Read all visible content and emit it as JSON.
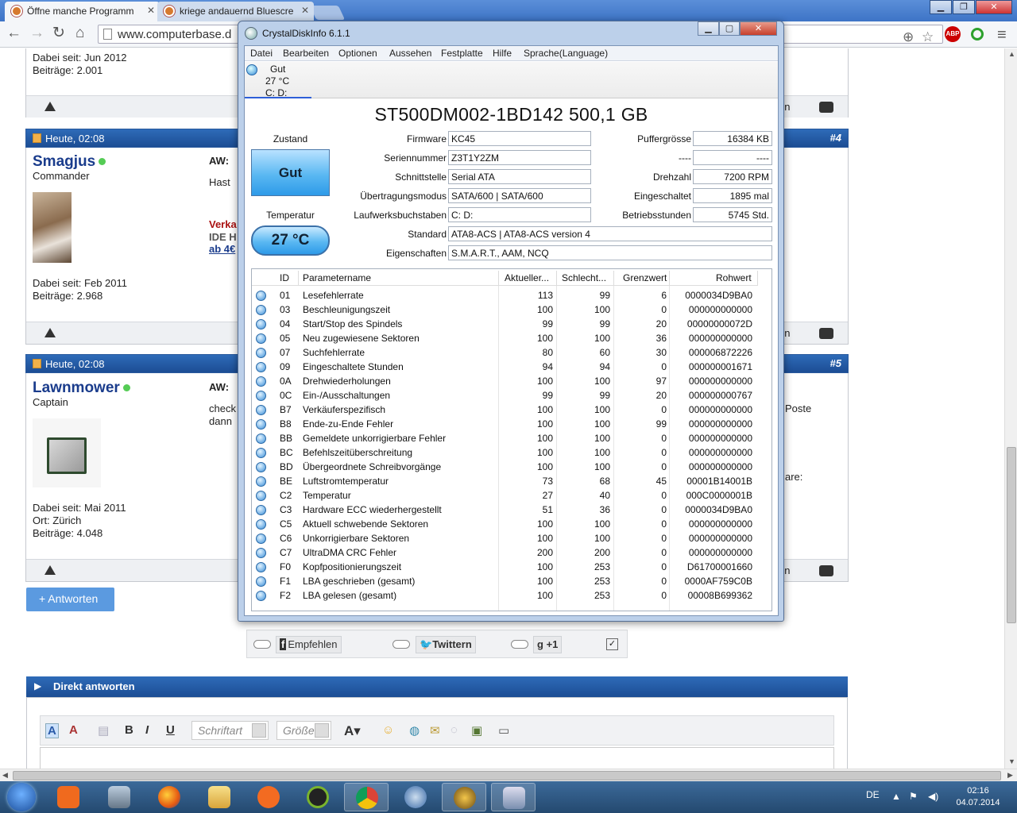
{
  "browser": {
    "tabs": [
      {
        "label": "Öffne manche Programm",
        "active": true
      },
      {
        "label": "kriege andauernd Bluescre",
        "active": false
      }
    ],
    "url": "www.computerbase.d"
  },
  "forum": {
    "post1": {
      "joined": "Dabei seit: Jun 2012",
      "posts": "Beiträge: 2.001"
    },
    "post4": {
      "time": "Heute, 02:08",
      "number": "#4",
      "username": "Smagjus",
      "rank": "Commander",
      "joined": "Dabei seit: Feb 2011",
      "posts": "Beiträge: 2.968",
      "title": "AW: ",
      "snippet": "Hast",
      "ad1": "Verka",
      "ad2": "IDE H",
      "ad3": "ab 4€",
      "right_text": "en"
    },
    "post5": {
      "time": "Heute, 02:08",
      "number": "#5",
      "username": "Lawnmower",
      "rank": "Captain",
      "joined": "Dabei seit: Mai 2011",
      "location": "Ort: Zürich",
      "posts": "Beiträge: 4.048",
      "title": "AW: ",
      "snippet1": "check",
      "snippet2": "dann",
      "right1": "Poste",
      "right2": "are:",
      "right_text": "en"
    },
    "post1_right": "en",
    "reply_button": "+ Antworten",
    "share": {
      "recommend": "Empfehlen",
      "twitter": "Twittern",
      "gplus": "+1"
    },
    "direct_reply": "Direkt antworten",
    "editor": {
      "font_label": "Schriftart",
      "size_label": "Größe"
    }
  },
  "taskbar": {
    "lang": "DE",
    "time": "02:16",
    "date": "04.07.2014"
  },
  "cdi": {
    "title": "CrystalDiskInfo 6.1.1",
    "menu": [
      "Datei",
      "Bearbeiten",
      "Optionen",
      "Aussehen",
      "Festplatte",
      "Hilfe",
      "Sprache(Language)"
    ],
    "disk_tab": {
      "status": "Gut",
      "temp": "27 °C",
      "letters": "C: D:"
    },
    "model": "ST500DM002-1BD142 500,1 GB",
    "zustand_label": "Zustand",
    "status": "Gut",
    "temperature_label": "Temperatur",
    "temperature": "27 °C",
    "fields": {
      "firmware_label": "Firmware",
      "firmware": "KC45",
      "serial_label": "Seriennummer",
      "serial": "Z3T1Y2ZM",
      "interface_label": "Schnittstelle",
      "interface": "Serial ATA",
      "transfer_label": "Übertragungsmodus",
      "transfer": "SATA/600 | SATA/600",
      "letters_label": "Laufwerksbuchstaben",
      "letters": "C: D:",
      "standard_label": "Standard",
      "standard": "ATA8-ACS | ATA8-ACS version 4",
      "features_label": "Eigenschaften",
      "features": "S.M.A.R.T., AAM, NCQ",
      "buffer_label": "Puffergrösse",
      "buffer": "16384 KB",
      "blank_label": "----",
      "blank": "----",
      "rpm_label": "Drehzahl",
      "rpm": "7200 RPM",
      "poweron_count_label": "Eingeschaltet",
      "poweron_count": "1895 mal",
      "hours_label": "Betriebsstunden",
      "hours": "5745 Std."
    },
    "columns": [
      "ID",
      "Parametername",
      "Aktueller...",
      "Schlecht...",
      "Grenzwert",
      "Rohwert"
    ],
    "smart": [
      {
        "id": "01",
        "name": "Lesefehlerrate",
        "cur": "113",
        "worst": "99",
        "thr": "6",
        "raw": "0000034D9BA0"
      },
      {
        "id": "03",
        "name": "Beschleunigungszeit",
        "cur": "100",
        "worst": "100",
        "thr": "0",
        "raw": "000000000000"
      },
      {
        "id": "04",
        "name": "Start/Stop des Spindels",
        "cur": "99",
        "worst": "99",
        "thr": "20",
        "raw": "00000000072D"
      },
      {
        "id": "05",
        "name": "Neu zugewiesene Sektoren",
        "cur": "100",
        "worst": "100",
        "thr": "36",
        "raw": "000000000000"
      },
      {
        "id": "07",
        "name": "Suchfehlerrate",
        "cur": "80",
        "worst": "60",
        "thr": "30",
        "raw": "000006872226"
      },
      {
        "id": "09",
        "name": "Eingeschaltete Stunden",
        "cur": "94",
        "worst": "94",
        "thr": "0",
        "raw": "000000001671"
      },
      {
        "id": "0A",
        "name": "Drehwiederholungen",
        "cur": "100",
        "worst": "100",
        "thr": "97",
        "raw": "000000000000"
      },
      {
        "id": "0C",
        "name": "Ein-/Ausschaltungen",
        "cur": "99",
        "worst": "99",
        "thr": "20",
        "raw": "000000000767"
      },
      {
        "id": "B7",
        "name": "Verkäuferspezifisch",
        "cur": "100",
        "worst": "100",
        "thr": "0",
        "raw": "000000000000"
      },
      {
        "id": "B8",
        "name": "Ende-zu-Ende Fehler",
        "cur": "100",
        "worst": "100",
        "thr": "99",
        "raw": "000000000000"
      },
      {
        "id": "BB",
        "name": "Gemeldete unkorrigierbare Fehler",
        "cur": "100",
        "worst": "100",
        "thr": "0",
        "raw": "000000000000"
      },
      {
        "id": "BC",
        "name": "Befehlszeitüberschreitung",
        "cur": "100",
        "worst": "100",
        "thr": "0",
        "raw": "000000000000"
      },
      {
        "id": "BD",
        "name": "Übergeordnete Schreibvorgänge",
        "cur": "100",
        "worst": "100",
        "thr": "0",
        "raw": "000000000000"
      },
      {
        "id": "BE",
        "name": "Luftstromtemperatur",
        "cur": "73",
        "worst": "68",
        "thr": "45",
        "raw": "00001B14001B"
      },
      {
        "id": "C2",
        "name": "Temperatur",
        "cur": "27",
        "worst": "40",
        "thr": "0",
        "raw": "000C0000001B"
      },
      {
        "id": "C3",
        "name": "Hardware ECC wiederhergestellt",
        "cur": "51",
        "worst": "36",
        "thr": "0",
        "raw": "0000034D9BA0"
      },
      {
        "id": "C5",
        "name": "Aktuell schwebende Sektoren",
        "cur": "100",
        "worst": "100",
        "thr": "0",
        "raw": "000000000000"
      },
      {
        "id": "C6",
        "name": "Unkorrigierbare Sektoren",
        "cur": "100",
        "worst": "100",
        "thr": "0",
        "raw": "000000000000"
      },
      {
        "id": "C7",
        "name": "UltraDMA CRC Fehler",
        "cur": "200",
        "worst": "200",
        "thr": "0",
        "raw": "000000000000"
      },
      {
        "id": "F0",
        "name": "Kopfpositionierungszeit",
        "cur": "100",
        "worst": "253",
        "thr": "0",
        "raw": "D61700001660"
      },
      {
        "id": "F1",
        "name": "LBA geschrieben (gesamt)",
        "cur": "100",
        "worst": "253",
        "thr": "0",
        "raw": "0000AF759C0B"
      },
      {
        "id": "F2",
        "name": "LBA gelesen (gesamt)",
        "cur": "100",
        "worst": "253",
        "thr": "0",
        "raw": "00008B699362"
      }
    ]
  }
}
